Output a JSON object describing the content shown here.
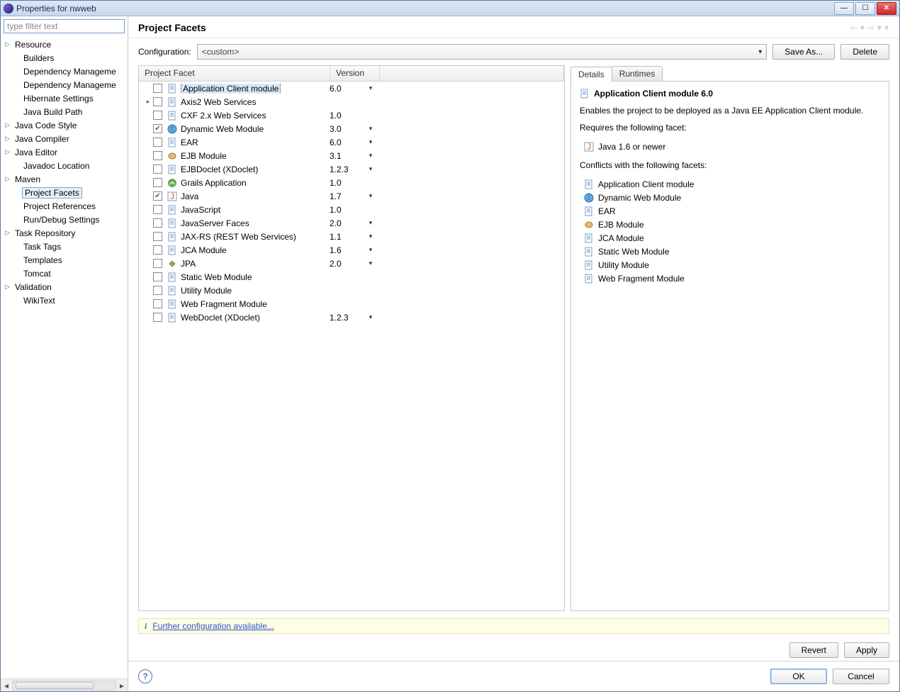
{
  "window": {
    "title": "Properties for nwweb"
  },
  "filter_placeholder": "type filter text",
  "nav": [
    {
      "label": "Resource",
      "exp": true,
      "indent": false
    },
    {
      "label": "Builders",
      "exp": false,
      "indent": true
    },
    {
      "label": "Dependency Manageme",
      "exp": false,
      "indent": true
    },
    {
      "label": "Dependency Manageme",
      "exp": false,
      "indent": true
    },
    {
      "label": "Hibernate Settings",
      "exp": false,
      "indent": true
    },
    {
      "label": "Java Build Path",
      "exp": false,
      "indent": true
    },
    {
      "label": "Java Code Style",
      "exp": true,
      "indent": false
    },
    {
      "label": "Java Compiler",
      "exp": true,
      "indent": false
    },
    {
      "label": "Java Editor",
      "exp": true,
      "indent": false
    },
    {
      "label": "Javadoc Location",
      "exp": false,
      "indent": true
    },
    {
      "label": "Maven",
      "exp": true,
      "indent": false
    },
    {
      "label": "Project Facets",
      "exp": false,
      "indent": true,
      "selected": true
    },
    {
      "label": "Project References",
      "exp": false,
      "indent": true
    },
    {
      "label": "Run/Debug Settings",
      "exp": false,
      "indent": true
    },
    {
      "label": "Task Repository",
      "exp": true,
      "indent": false
    },
    {
      "label": "Task Tags",
      "exp": false,
      "indent": true
    },
    {
      "label": "Templates",
      "exp": false,
      "indent": true
    },
    {
      "label": "Tomcat",
      "exp": false,
      "indent": true
    },
    {
      "label": "Validation",
      "exp": true,
      "indent": false
    },
    {
      "label": "WikiText",
      "exp": false,
      "indent": true
    }
  ],
  "page_title": "Project Facets",
  "config": {
    "label": "Configuration:",
    "value": "<custom>",
    "save_as": "Save As...",
    "delete": "Delete"
  },
  "columns": {
    "facet": "Project Facet",
    "version": "Version"
  },
  "facets": [
    {
      "name": "Application Client module",
      "ver": "6.0",
      "dd": true,
      "chk": false,
      "icon": "doc",
      "selected": true,
      "exp": ""
    },
    {
      "name": "Axis2 Web Services",
      "ver": "",
      "dd": false,
      "chk": false,
      "icon": "doc",
      "exp": "▸"
    },
    {
      "name": "CXF 2.x Web Services",
      "ver": "1.0",
      "dd": false,
      "chk": false,
      "icon": "doc",
      "exp": ""
    },
    {
      "name": "Dynamic Web Module",
      "ver": "3.0",
      "dd": true,
      "chk": true,
      "icon": "globe",
      "exp": ""
    },
    {
      "name": "EAR",
      "ver": "6.0",
      "dd": true,
      "chk": false,
      "icon": "doc",
      "exp": ""
    },
    {
      "name": "EJB Module",
      "ver": "3.1",
      "dd": true,
      "chk": false,
      "icon": "bean",
      "exp": ""
    },
    {
      "name": "EJBDoclet (XDoclet)",
      "ver": "1.2.3",
      "dd": true,
      "chk": false,
      "icon": "doc",
      "exp": ""
    },
    {
      "name": "Grails Application",
      "ver": "1.0",
      "dd": false,
      "chk": false,
      "icon": "grails",
      "exp": ""
    },
    {
      "name": "Java",
      "ver": "1.7",
      "dd": true,
      "chk": true,
      "icon": "java",
      "exp": ""
    },
    {
      "name": "JavaScript",
      "ver": "1.0",
      "dd": false,
      "chk": false,
      "icon": "doc",
      "exp": ""
    },
    {
      "name": "JavaServer Faces",
      "ver": "2.0",
      "dd": true,
      "chk": false,
      "icon": "doc",
      "exp": ""
    },
    {
      "name": "JAX-RS (REST Web Services)",
      "ver": "1.1",
      "dd": true,
      "chk": false,
      "icon": "doc",
      "exp": ""
    },
    {
      "name": "JCA Module",
      "ver": "1.6",
      "dd": true,
      "chk": false,
      "icon": "doc",
      "exp": ""
    },
    {
      "name": "JPA",
      "ver": "2.0",
      "dd": true,
      "chk": false,
      "icon": "jpa",
      "exp": ""
    },
    {
      "name": "Static Web Module",
      "ver": "",
      "dd": false,
      "chk": false,
      "icon": "doc",
      "exp": ""
    },
    {
      "name": "Utility Module",
      "ver": "",
      "dd": false,
      "chk": false,
      "icon": "doc",
      "exp": ""
    },
    {
      "name": "Web Fragment Module",
      "ver": "",
      "dd": false,
      "chk": false,
      "icon": "doc",
      "exp": ""
    },
    {
      "name": "WebDoclet (XDoclet)",
      "ver": "1.2.3",
      "dd": true,
      "chk": false,
      "icon": "doc",
      "exp": ""
    }
  ],
  "tabs": {
    "details": "Details",
    "runtimes": "Runtimes"
  },
  "detail": {
    "title": "Application Client module 6.0",
    "desc": "Enables the project to be deployed as a Java EE Application Client module.",
    "requires_label": "Requires the following facet:",
    "requires": [
      {
        "label": "Java 1.6 or newer",
        "icon": "java"
      }
    ],
    "conflicts_label": "Conflicts with the following facets:",
    "conflicts": [
      {
        "label": "Application Client module",
        "icon": "doc"
      },
      {
        "label": "Dynamic Web Module",
        "icon": "globe"
      },
      {
        "label": "EAR",
        "icon": "doc"
      },
      {
        "label": "EJB Module",
        "icon": "bean"
      },
      {
        "label": "JCA Module",
        "icon": "doc"
      },
      {
        "label": "Static Web Module",
        "icon": "doc"
      },
      {
        "label": "Utility Module",
        "icon": "doc"
      },
      {
        "label": "Web Fragment Module",
        "icon": "doc"
      }
    ]
  },
  "info_link": "Further configuration available...",
  "buttons": {
    "revert": "Revert",
    "apply": "Apply",
    "ok": "OK",
    "cancel": "Cancel"
  }
}
